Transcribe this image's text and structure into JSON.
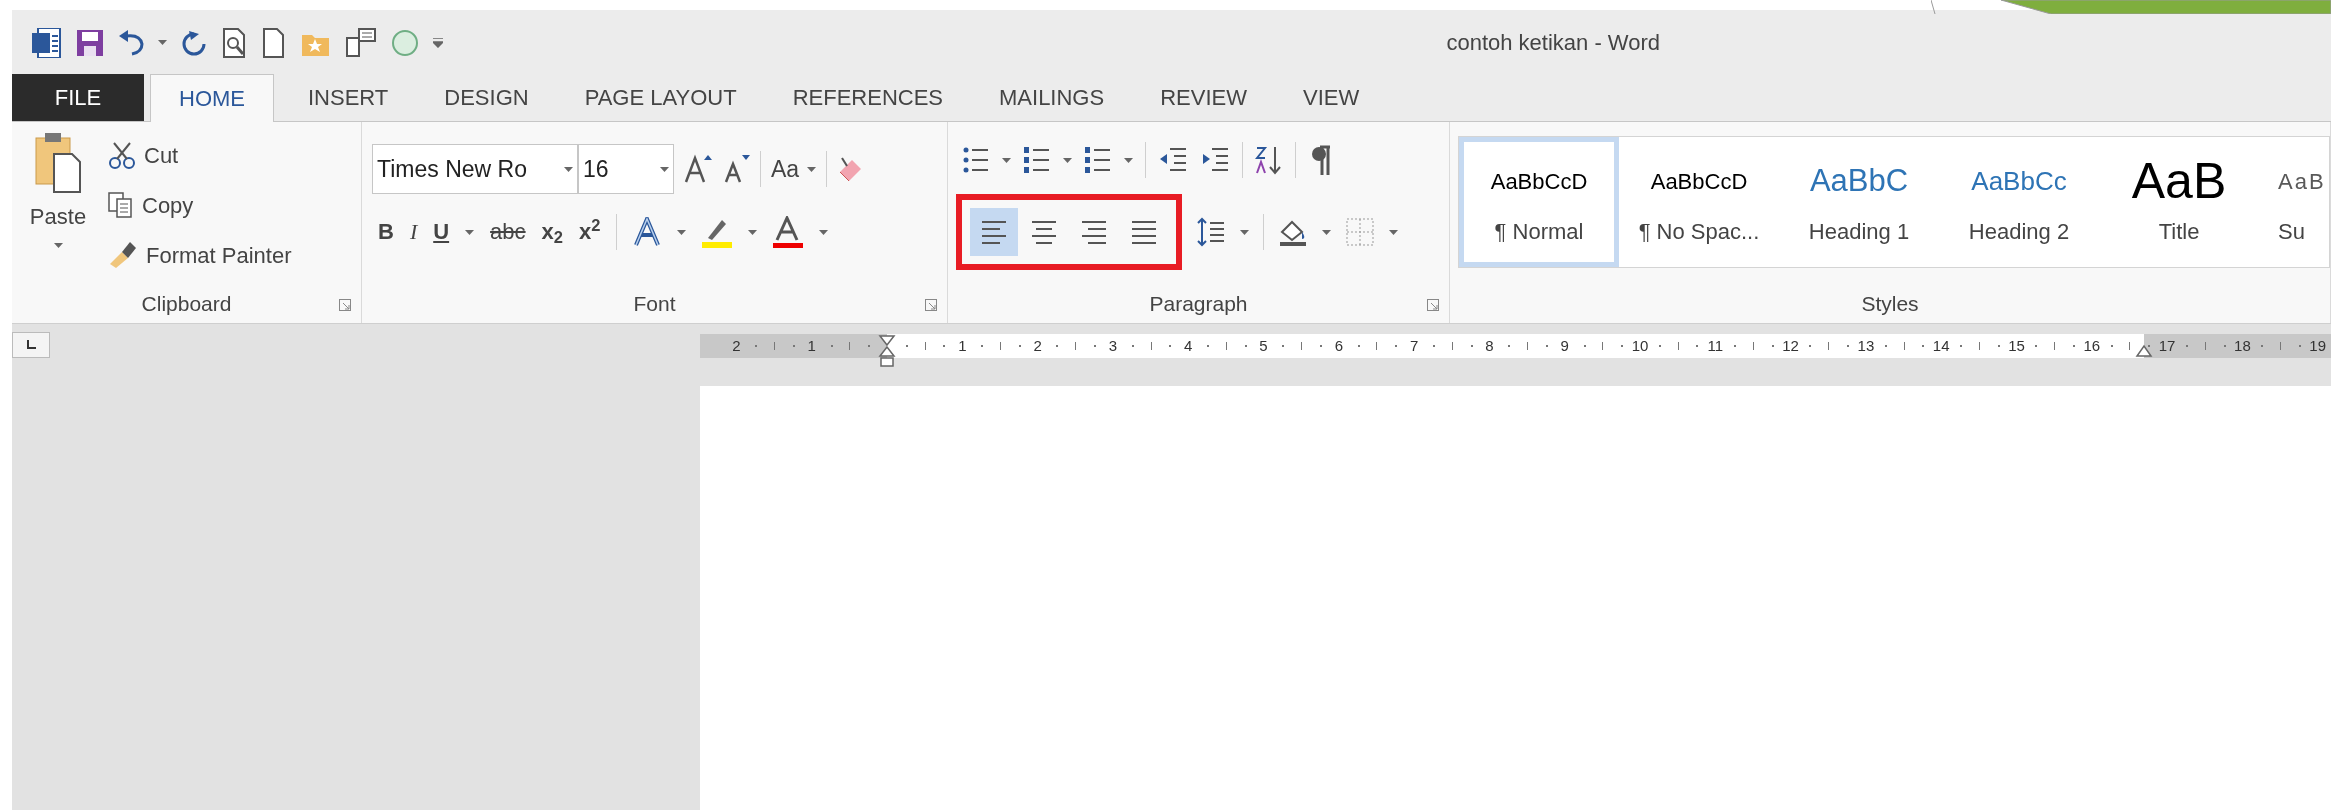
{
  "window": {
    "title": "contoh ketikan - Word"
  },
  "tabs": [
    {
      "label": "FILE",
      "kind": "file",
      "selected": false
    },
    {
      "label": "HOME",
      "kind": "tab",
      "selected": true
    },
    {
      "label": "INSERT",
      "kind": "tab",
      "selected": false
    },
    {
      "label": "DESIGN",
      "kind": "tab",
      "selected": false
    },
    {
      "label": "PAGE LAYOUT",
      "kind": "tab",
      "selected": false
    },
    {
      "label": "REFERENCES",
      "kind": "tab",
      "selected": false
    },
    {
      "label": "MAILINGS",
      "kind": "tab",
      "selected": false
    },
    {
      "label": "REVIEW",
      "kind": "tab",
      "selected": false
    },
    {
      "label": "VIEW",
      "kind": "tab",
      "selected": false
    }
  ],
  "clipboard": {
    "label": "Clipboard",
    "paste": "Paste",
    "cut": "Cut",
    "copy": "Copy",
    "format_painter": "Format Painter"
  },
  "font": {
    "label": "Font",
    "font_name": "Times New Ro",
    "font_size": "16",
    "change_case": "Aa",
    "bold": "B",
    "italic": "I",
    "underline": "U",
    "strikethrough": "abc",
    "subscript": "x$_{2}$",
    "superscript": "x$^{2}$"
  },
  "paragraph": {
    "label": "Paragraph",
    "alignment": {
      "highlighted": true,
      "buttons": [
        {
          "selected": true
        },
        {
          "selected": false
        },
        {
          "selected": false
        },
        {
          "selected": false
        }
      ]
    }
  },
  "styles": {
    "label": "Styles",
    "items": [
      {
        "kind": "normal",
        "preview": "AaBbCcD",
        "label": "¶ Normal",
        "selected": true
      },
      {
        "kind": "normal",
        "preview": "AaBbCcD",
        "label": "¶ No Spac...",
        "selected": false
      },
      {
        "kind": "heading1",
        "preview": "AaBbC",
        "label": "Heading 1",
        "selected": false
      },
      {
        "kind": "heading2",
        "preview": "AaBbCc",
        "label": "Heading 2",
        "selected": false
      },
      {
        "kind": "title",
        "preview": "AaB",
        "label": "Title",
        "selected": false
      },
      {
        "kind": "subtitle",
        "preview": "AaB",
        "label": "Su",
        "selected": false
      }
    ]
  },
  "ruler": {
    "labels": [
      "2",
      "1",
      "1",
      "2",
      "3",
      "4",
      "5",
      "6",
      "7",
      "8",
      "9",
      "10",
      "11",
      "12",
      "13",
      "14",
      "15",
      "16",
      "17",
      "18",
      "19"
    ]
  }
}
